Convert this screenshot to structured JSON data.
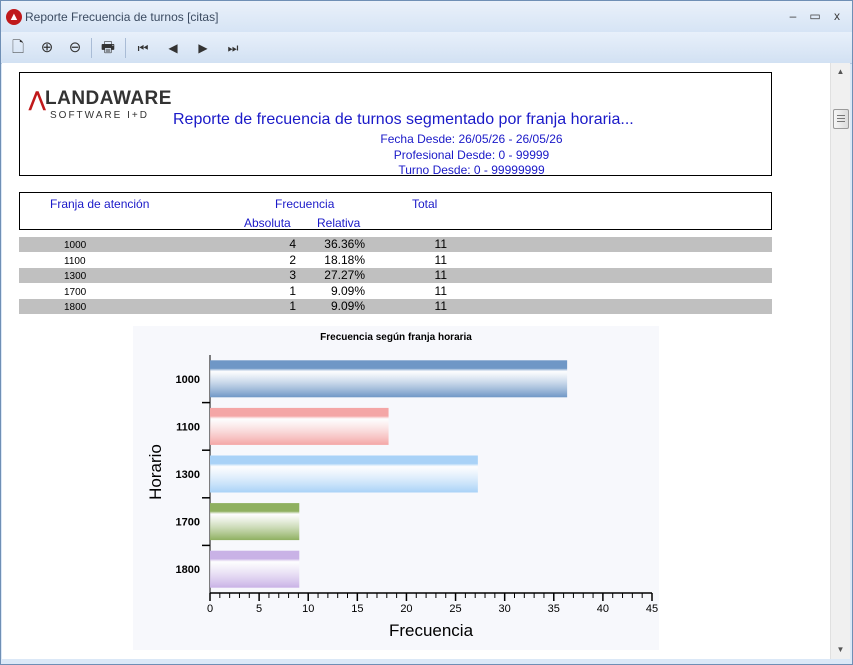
{
  "window": {
    "title": "Reporte Frecuencia de turnos [citas]",
    "app_icon": "landaware-app-icon"
  },
  "window_buttons": {
    "minimize": "–",
    "maximize": "▭",
    "close": "x"
  },
  "toolbar": {
    "buttons": [
      {
        "name": "print-preview-icon",
        "glyph": "🗋"
      },
      {
        "name": "zoom-in-icon",
        "glyph": "⊕"
      },
      {
        "name": "zoom-out-icon",
        "glyph": "⊖"
      },
      {
        "name": "printer-icon",
        "glyph": "🖶"
      },
      {
        "name": "first-page-icon",
        "glyph": "⏮"
      },
      {
        "name": "previous-page-icon",
        "glyph": "◀"
      },
      {
        "name": "next-page-icon",
        "glyph": "▶"
      },
      {
        "name": "last-page-icon",
        "glyph": "⏭"
      }
    ]
  },
  "report": {
    "logo": {
      "mark": "⋀",
      "name": "LANDAWARE",
      "tagline": "SOFTWARE I+D"
    },
    "title": "Reporte de frecuencia de turnos segmentado por franja horaria...",
    "fecha": "Fecha Desde: 26/05/26 - 26/05/26",
    "profesional": "Profesional Desde: 0 - 99999",
    "turno": "Turno Desde: 0 - 99999999",
    "columns": {
      "franja": "Franja de atención",
      "frecuencia": "Frecuencia",
      "total": "Total",
      "absoluta": "Absoluta",
      "relativa": "Relativa"
    },
    "rows": [
      {
        "franja": "1000",
        "absoluta": "4",
        "relativa": "36.36%",
        "total": "11"
      },
      {
        "franja": "1100",
        "absoluta": "2",
        "relativa": "18.18%",
        "total": "11"
      },
      {
        "franja": "1300",
        "absoluta": "3",
        "relativa": "27.27%",
        "total": "11"
      },
      {
        "franja": "1700",
        "absoluta": "1",
        "relativa": "9.09%",
        "total": "11"
      },
      {
        "franja": "1800",
        "absoluta": "1",
        "relativa": "9.09%",
        "total": "11"
      }
    ]
  },
  "chart_data": {
    "type": "bar",
    "orientation": "horizontal",
    "title": "Frecuencia según franja horaria",
    "xlabel": "Frecuencia",
    "ylabel": "Horario",
    "categories": [
      "1000",
      "1100",
      "1300",
      "1700",
      "1800"
    ],
    "values": [
      36.36,
      18.18,
      27.27,
      9.09,
      9.09
    ],
    "colors": [
      "#6f97c6",
      "#f4a6a6",
      "#a9d2f7",
      "#8fb060",
      "#c9b2e6"
    ],
    "xlim": [
      0,
      45
    ],
    "xticks": [
      0,
      5,
      10,
      15,
      20,
      25,
      30,
      35,
      40,
      45
    ],
    "grid": false,
    "legend": "none"
  }
}
